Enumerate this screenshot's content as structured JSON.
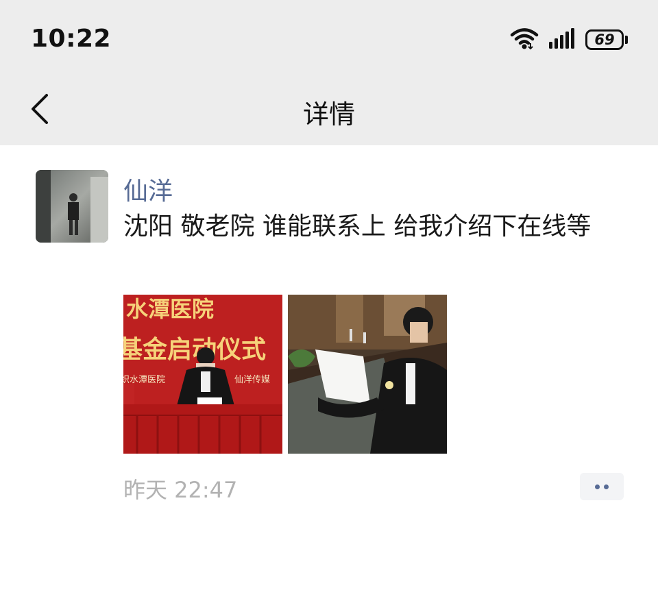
{
  "status_bar": {
    "time": "10:22",
    "battery": "69",
    "icons": [
      "wifi-icon",
      "signal-icon",
      "battery-icon"
    ]
  },
  "nav": {
    "title": "详情",
    "back_icon": "chevron-left-icon"
  },
  "post": {
    "username": "仙洋",
    "text": "沈阳 敬老院 谁能联系上 给我介绍下在线等",
    "timestamp": "昨天 22:47",
    "images": [
      {
        "desc_id": "signing-ceremony-photo",
        "banner_line1": "水潭医院",
        "banner_line2": "基金启动仪式",
        "banner_line3_left": "织水潭医院",
        "banner_line3_right": "仙洋传媒"
      },
      {
        "desc_id": "meeting-room-photo"
      }
    ],
    "more_icon": "more-dots-icon"
  },
  "colors": {
    "header_bg": "#ededed",
    "username": "#576b95",
    "timestamp": "#b2b2b2",
    "banner_red": "#b31b1b",
    "banner_gold": "#f6d27a"
  }
}
